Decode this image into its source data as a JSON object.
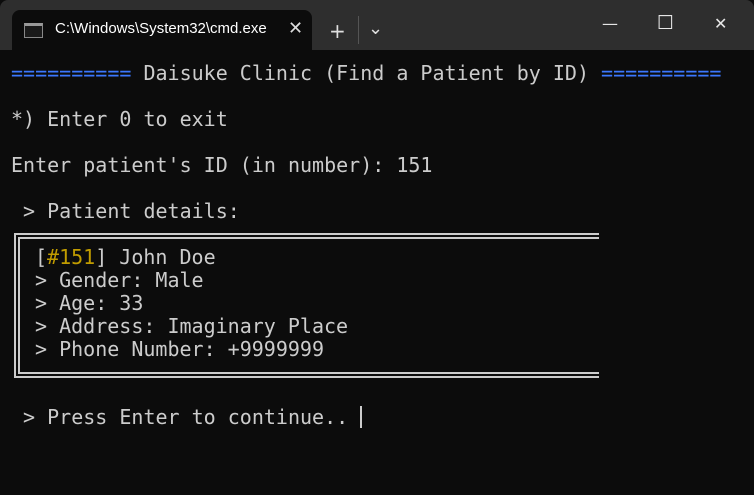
{
  "window": {
    "tab_title": "C:\\Windows\\System32\\cmd.exe",
    "new_tab": "+",
    "dropdown": "⌄",
    "minimize": "—",
    "maximize": "☐",
    "close": "✕",
    "tab_close": "✕"
  },
  "terminal": {
    "header_bar_left": "==========",
    "header_title": " Daisuke Clinic (Find a Patient by ID) ",
    "header_bar_right": "==========",
    "exit_hint": "*) Enter 0 to exit",
    "prompt": "Enter patient's ID (in number): 151",
    "details_label": " > Patient details:",
    "patient": {
      "id_open": "[",
      "id": "#151",
      "id_close": "] John Doe",
      "gender": "> Gender: Male",
      "age": "> Age: 33",
      "address": "> Address: Imaginary Place",
      "phone": "> Phone Number: +9999999"
    },
    "continue": " > Press Enter to continue.. "
  }
}
